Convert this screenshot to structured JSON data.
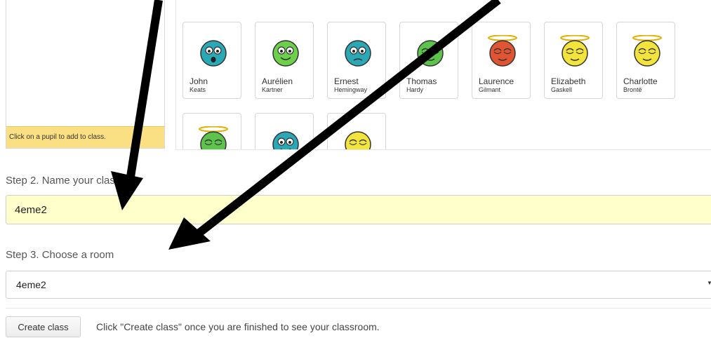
{
  "left_panel": {
    "hint": "Click on a pupil to add to class."
  },
  "pupils": [
    {
      "first": "John",
      "last": "Keats",
      "color": "#2aa8b5",
      "expression": "shocked",
      "halo": false,
      "row": 0,
      "col": 0
    },
    {
      "first": "Aurélien",
      "last": "Kartner",
      "color": "#6dd04a",
      "expression": "smile",
      "halo": false,
      "row": 0,
      "col": 1
    },
    {
      "first": "Ernest",
      "last": "Hemingway",
      "color": "#2aa8b5",
      "expression": "sad",
      "halo": false,
      "row": 0,
      "col": 2
    },
    {
      "first": "Thomas",
      "last": "Hardy",
      "color": "#5cc44a",
      "expression": "sleepy",
      "halo": false,
      "row": 0,
      "col": 3
    },
    {
      "first": "Laurence",
      "last": "Gilmant",
      "color": "#e05432",
      "expression": "sleepy",
      "halo": true,
      "row": 0,
      "col": 4
    },
    {
      "first": "Elizabeth",
      "last": "Gaskell",
      "color": "#f2e43a",
      "expression": "sleepy",
      "halo": true,
      "row": 0,
      "col": 5
    },
    {
      "first": "Charlotte",
      "last": "Brontë",
      "color": "#f2e43a",
      "expression": "sleepy",
      "halo": true,
      "row": 0,
      "col": 6
    },
    {
      "first": "",
      "last": "",
      "color": "#5cc44a",
      "expression": "sleepy",
      "halo": true,
      "row": 1,
      "col": 0
    },
    {
      "first": "",
      "last": "",
      "color": "#2aa8b5",
      "expression": "smile",
      "halo": false,
      "row": 1,
      "col": 1
    },
    {
      "first": "",
      "last": "",
      "color": "#f2e43a",
      "expression": "sleepy",
      "halo": false,
      "row": 1,
      "col": 2
    }
  ],
  "step2": {
    "label": "Step 2. Name your class",
    "value": "4eme2"
  },
  "step3": {
    "label": "Step 3. Choose a room",
    "selected": "4eme2"
  },
  "create_button": "Create class",
  "create_hint": "Click \"Create class\" once you are finished to see your classroom."
}
